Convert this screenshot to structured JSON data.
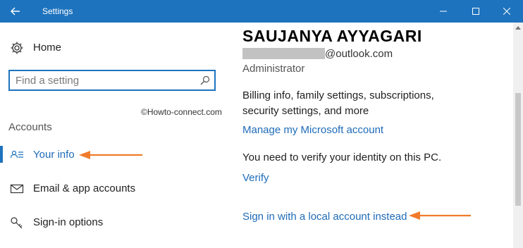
{
  "window": {
    "title": "Settings",
    "back": "back",
    "minimize": "minimize",
    "maximize": "maximize",
    "close": "close"
  },
  "sidebar": {
    "home_label": "Home",
    "search_placeholder": "Find a setting",
    "watermark": "©Howto-connect.com",
    "section_title": "Accounts",
    "items": [
      {
        "label": "Your info",
        "icon": "person-list-icon",
        "selected": true
      },
      {
        "label": "Email & app accounts",
        "icon": "mail-icon",
        "selected": false
      },
      {
        "label": "Sign-in options",
        "icon": "key-icon",
        "selected": false
      }
    ]
  },
  "main": {
    "account_name": "SAUJANYA AYYAGARI",
    "email_suffix": "@outlook.com",
    "role": "Administrator",
    "billing_desc": "Billing info, family settings, subscriptions, security settings, and more",
    "manage_link": "Manage my Microsoft account",
    "verify_text": "You need to verify your identity on this PC.",
    "verify_link": "Verify",
    "local_account_link": "Sign in with a local account instead"
  },
  "colors": {
    "accent": "#1e73be",
    "link": "#1e6bb8",
    "annotation_arrow": "#f07b2a"
  }
}
